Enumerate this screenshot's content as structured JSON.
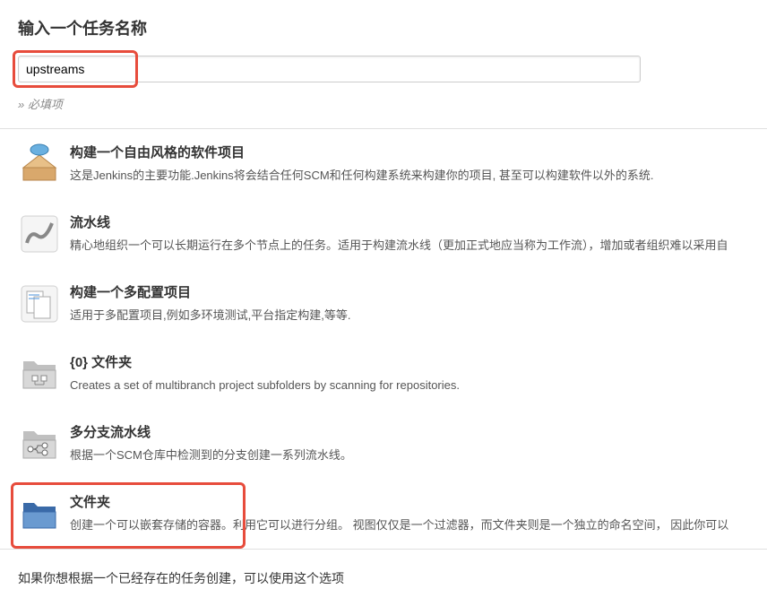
{
  "header": {
    "title": "输入一个任务名称",
    "input_value": "upstreams",
    "required_label": "必填项"
  },
  "items": [
    {
      "key": "freestyle",
      "title": "构建一个自由风格的软件项目",
      "desc": "这是Jenkins的主要功能.Jenkins将会结合任何SCM和任何构建系统来构建你的项目, 甚至可以构建软件以外的系统."
    },
    {
      "key": "pipeline",
      "title": "流水线",
      "desc": "精心地组织一个可以长期运行在多个节点上的任务。适用于构建流水线（更加正式地应当称为工作流），增加或者组织难以采用自"
    },
    {
      "key": "multiconfig",
      "title": "构建一个多配置项目",
      "desc": "适用于多配置项目,例如多环境测试,平台指定构建,等等."
    },
    {
      "key": "orgfolder",
      "title": "{0} 文件夹",
      "desc": "Creates a set of multibranch project subfolders by scanning for repositories."
    },
    {
      "key": "multibranch",
      "title": "多分支流水线",
      "desc": "根据一个SCM仓库中检测到的分支创建一系列流水线。"
    },
    {
      "key": "folder",
      "title": "文件夹",
      "desc": "创建一个可以嵌套存储的容器。利用它可以进行分组。 视图仅仅是一个过滤器，而文件夹则是一个独立的命名空间， 因此你可以"
    }
  ],
  "footer": {
    "copy_text": "如果你想根据一个已经存在的任务创建，可以使用这个选项"
  }
}
